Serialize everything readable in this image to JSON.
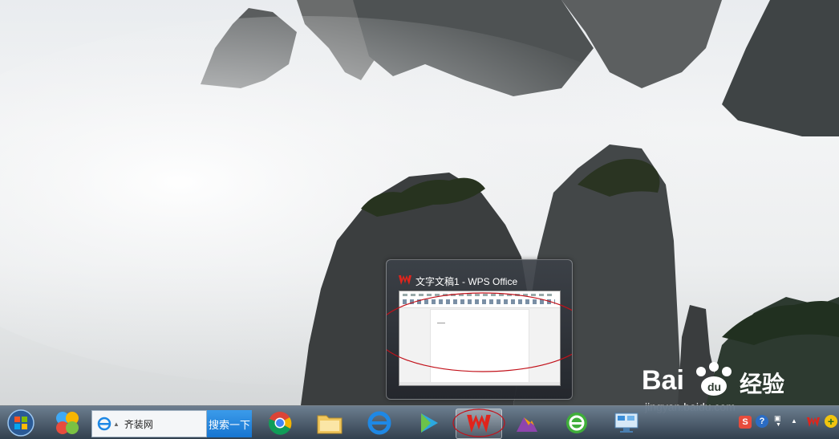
{
  "desktop": {
    "wallpaper": "mountain-landscape"
  },
  "thumbnail": {
    "title": "文字文稿1 - WPS Office",
    "icon": "wps-icon"
  },
  "watermark": {
    "brand": "Bai",
    "brand2": "经验",
    "url": "jingyan.baidu.com"
  },
  "taskbar": {
    "search_text": "齐装网",
    "search_button": "搜索一下",
    "items": [
      "start",
      "app-quad",
      "chrome",
      "file-explorer",
      "ie",
      "video-player",
      "wps",
      "ai-app",
      "360-browser",
      "network-app"
    ]
  },
  "colors": {
    "accent": "#1675d1",
    "wps_red": "#e0241b",
    "annotation": "#c2111a"
  }
}
